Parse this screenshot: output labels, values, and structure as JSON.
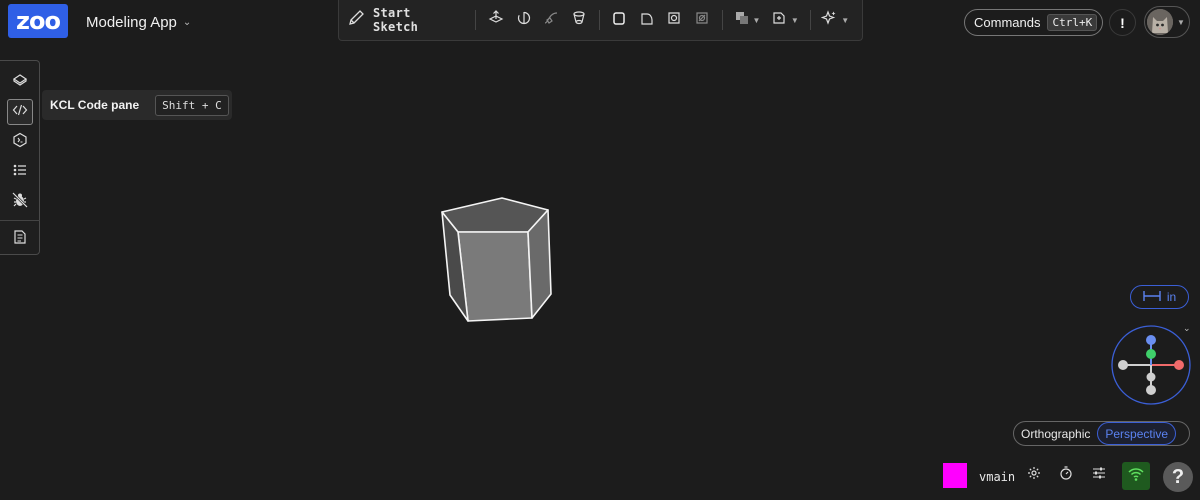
{
  "app": {
    "logo_text": "zoo",
    "title": "Modeling App"
  },
  "toolbar": {
    "start_sketch_label": "Start Sketch",
    "icons": [
      "pencil-icon",
      "extrude-icon",
      "revolve-icon",
      "sweep-icon",
      "loft-icon",
      "shell-icon",
      "fillet-icon",
      "offset-plane-icon",
      "helix-icon",
      "boolean-icon",
      "plane-icon",
      "text-to-cad-icon"
    ]
  },
  "header_right": {
    "commands_label": "Commands",
    "commands_shortcut": "Ctrl+K",
    "notice_label": "!"
  },
  "left_panel": {
    "items": [
      {
        "icon": "feature-tree-icon",
        "active": false
      },
      {
        "icon": "code-icon",
        "active": true
      },
      {
        "icon": "kcl-docs-icon",
        "active": false
      },
      {
        "icon": "variables-icon",
        "active": false
      },
      {
        "icon": "debug-icon",
        "active": false
      },
      {
        "icon": "files-icon",
        "active": false
      }
    ]
  },
  "tooltip": {
    "label": "KCL Code pane",
    "shortcut": "Shift + C"
  },
  "viewport": {
    "units_label": "in",
    "projection": {
      "options": [
        "Orthographic",
        "Perspective"
      ],
      "selected": "Perspective"
    },
    "axis_colors": {
      "x": "#f06a6a",
      "y": "#3fcf6a",
      "z": "#6a8ef0",
      "neutral": "#cfcfcf"
    }
  },
  "status_bar": {
    "accent_color": "#ff00ff",
    "branch": "vmain",
    "help_label": "?"
  }
}
